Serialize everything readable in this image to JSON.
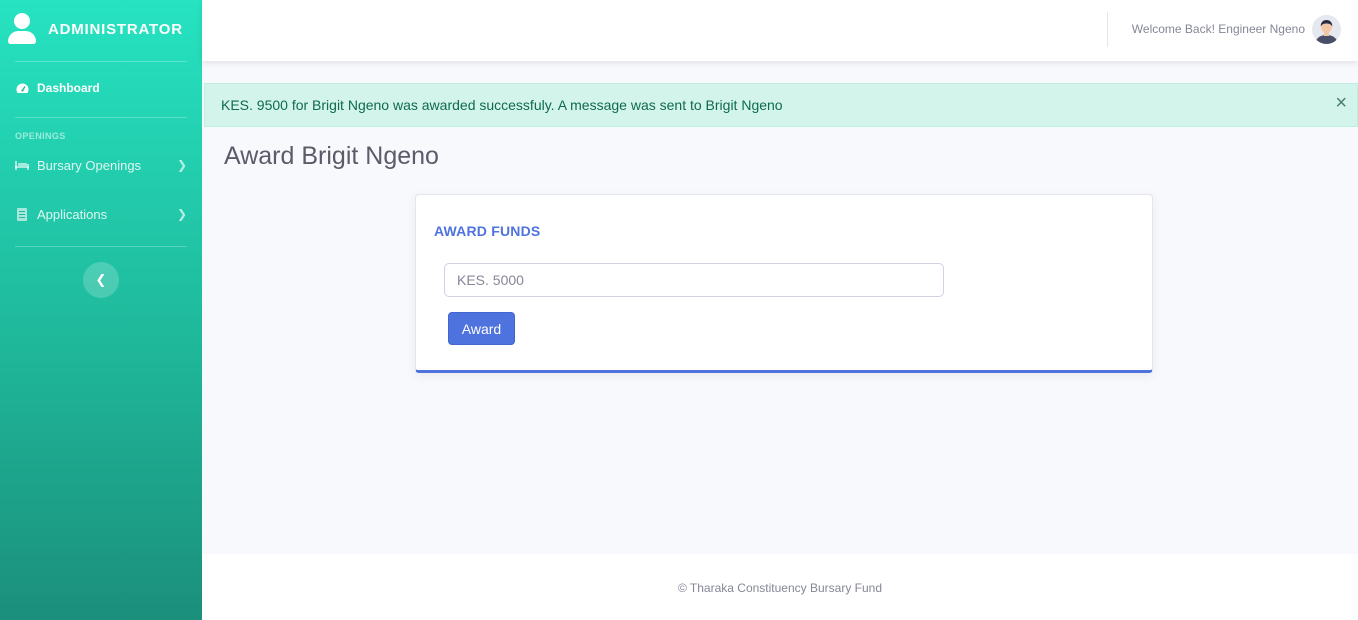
{
  "sidebar": {
    "brand": "ADMINISTRATOR",
    "dashboard_label": "Dashboard",
    "section_heading": "OPENINGS",
    "items": [
      {
        "label": "Bursary Openings"
      },
      {
        "label": "Applications"
      }
    ]
  },
  "topbar": {
    "welcome": "Welcome Back! Engineer Ngeno"
  },
  "alert": {
    "message": "KES. 9500 for Brigit Ngeno was awarded successfuly. A message was sent to Brigit Ngeno",
    "close_glyph": "×"
  },
  "page": {
    "title": "Award Brigit Ngeno"
  },
  "card": {
    "title": "AWARD FUNDS",
    "amount_placeholder": "KES. 5000",
    "award_button": "Award"
  },
  "footer": {
    "copyright": "© Tharaka Constituency Bursary Fund"
  },
  "colors": {
    "sidebar_top": "#26e3c1",
    "sidebar_bottom": "#1b8f7b",
    "primary": "#4e73df",
    "alert_bg": "#d3f4ea"
  }
}
